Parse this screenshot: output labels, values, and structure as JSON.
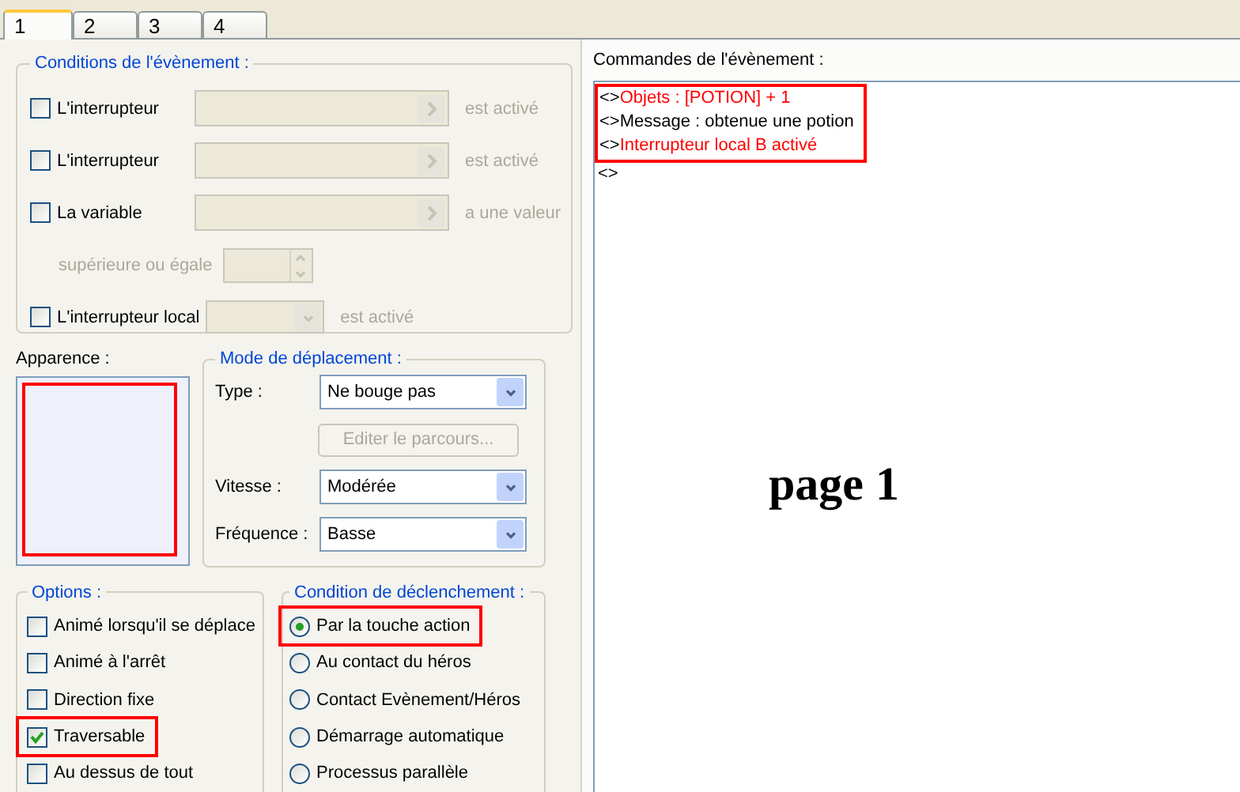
{
  "tabs": [
    {
      "label": "1",
      "selected": true
    },
    {
      "label": "2",
      "selected": false
    },
    {
      "label": "3",
      "selected": false
    },
    {
      "label": "4",
      "selected": false
    }
  ],
  "conditions": {
    "title": "Conditions de l'évènement :",
    "rows": [
      {
        "kind": "select",
        "label": "L'interrupteur",
        "checked": false,
        "disabled": true,
        "suffix": "est activé"
      },
      {
        "kind": "select",
        "label": "L'interrupteur",
        "checked": false,
        "disabled": true,
        "suffix": "est activé"
      },
      {
        "kind": "select",
        "label": "La variable",
        "checked": false,
        "disabled": true,
        "suffix": "a une valeur"
      },
      {
        "kind": "spin",
        "label": "supérieure ou égale",
        "disabled": true
      },
      {
        "kind": "dropdown",
        "label": "L'interrupteur local",
        "checked": false,
        "disabled": true,
        "suffix": "est activé"
      }
    ]
  },
  "appearance": {
    "label": "Apparence :",
    "highlighted": true
  },
  "movement": {
    "title": "Mode de déplacement :",
    "rows": [
      {
        "kind": "dropdown",
        "label": "Type :",
        "value": "Ne bouge pas"
      },
      {
        "kind": "button",
        "label": "Editer le parcours...",
        "disabled": true
      },
      {
        "kind": "dropdown",
        "label": "Vitesse :",
        "value": "Modérée"
      },
      {
        "kind": "dropdown",
        "label": "Fréquence :",
        "value": "Basse"
      }
    ]
  },
  "options": {
    "title": "Options :",
    "items": [
      {
        "label": "Animé lorsqu'il se déplace",
        "checked": false,
        "highlighted": false
      },
      {
        "label": "Animé à l'arrêt",
        "checked": false,
        "highlighted": false
      },
      {
        "label": "Direction fixe",
        "checked": false,
        "highlighted": false
      },
      {
        "label": "Traversable",
        "checked": true,
        "highlighted": true
      },
      {
        "label": "Au dessus de tout",
        "checked": false,
        "highlighted": false
      }
    ]
  },
  "trigger": {
    "title": "Condition de déclenchement :",
    "items": [
      {
        "label": "Par la touche action",
        "selected": true,
        "highlighted": true
      },
      {
        "label": "Au contact du héros",
        "selected": false,
        "highlighted": false
      },
      {
        "label": "Contact Evènement/Héros",
        "selected": false,
        "highlighted": false
      },
      {
        "label": "Démarrage automatique",
        "selected": false,
        "highlighted": false
      },
      {
        "label": "Processus parallèle",
        "selected": false,
        "highlighted": false
      }
    ]
  },
  "commands": {
    "label": "Commandes de l'évènement :",
    "lines": [
      {
        "marker": "<>",
        "text": "Objets : [POTION] + 1",
        "color": "#ff0000",
        "highlighted": true
      },
      {
        "marker": "<>",
        "text": "Message : obtenue une potion",
        "color": "#000000",
        "highlighted": true
      },
      {
        "marker": "<>",
        "text": "Interrupteur local B activé",
        "color": "#ff0000",
        "highlighted": true
      },
      {
        "marker": "<>",
        "highlighted": false
      }
    ]
  },
  "page_caption": "page 1"
}
